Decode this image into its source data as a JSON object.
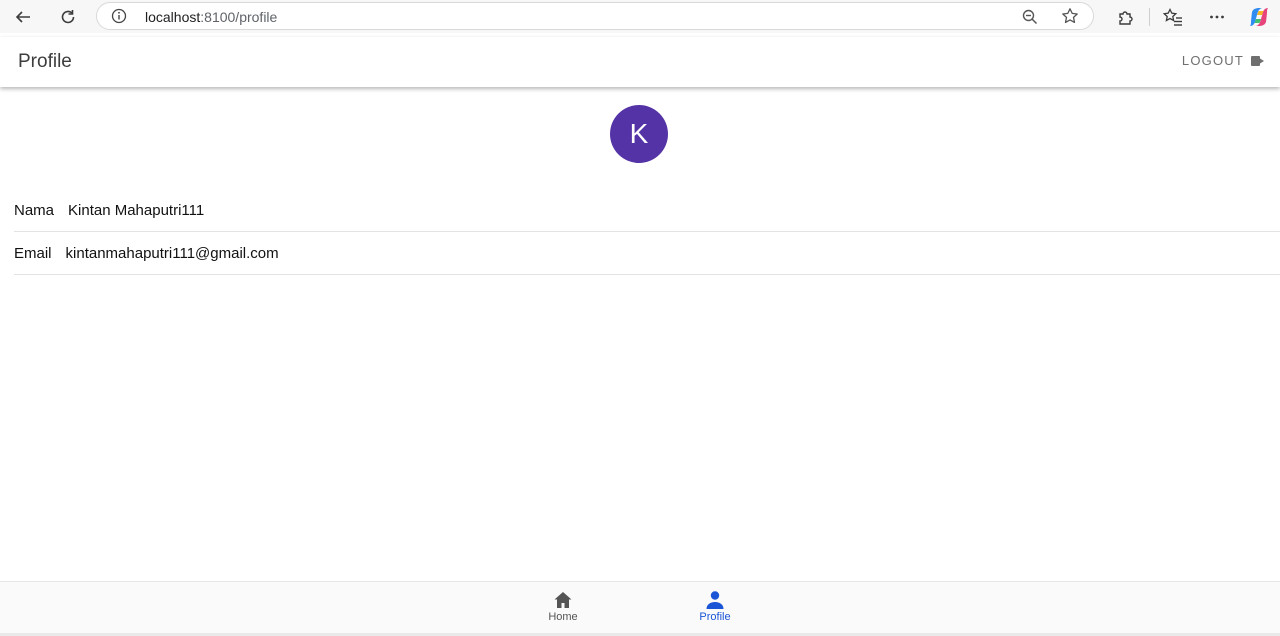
{
  "browser": {
    "url_host": "localhost",
    "url_path": ":8100/profile"
  },
  "header": {
    "title": "Profile",
    "logout_label": "LOGOUT"
  },
  "profile": {
    "avatar_initial": "K",
    "avatar_color": "#5433a6",
    "fields": [
      {
        "label": "Nama",
        "value": "Kintan Mahaputri111"
      },
      {
        "label": "Email",
        "value": "kintanmahaputri111@gmail.com"
      }
    ]
  },
  "tabs": [
    {
      "label": "Home",
      "icon": "home-icon",
      "active": false
    },
    {
      "label": "Profile",
      "icon": "person-icon",
      "active": true
    }
  ],
  "colors": {
    "accent": "#1a55d6"
  }
}
